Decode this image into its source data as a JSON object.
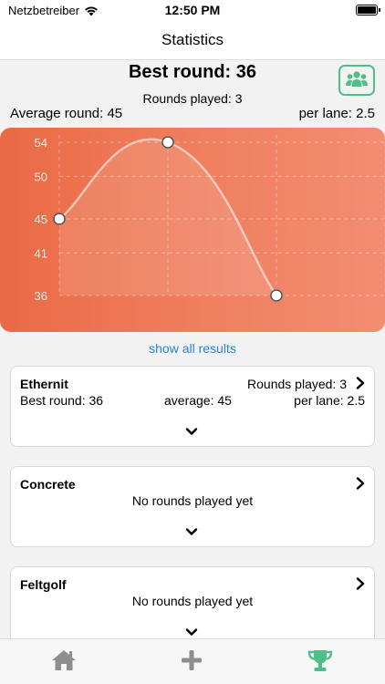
{
  "status_bar": {
    "carrier": "Netzbetreiber",
    "time": "12:50 PM"
  },
  "nav": {
    "title": "Statistics"
  },
  "summary": {
    "best_round": "Best round: 36",
    "rounds_played": "Rounds played: 3",
    "average_round": "Average round: 45",
    "per_lane": "per lane: 2.5"
  },
  "icons": {
    "group": "group-icon",
    "chevron_right": "chevron-right-icon",
    "chevron_down": "chevron-down-icon",
    "home": "home-icon",
    "plus": "plus-icon",
    "trophy": "trophy-icon"
  },
  "colors": {
    "accent_green": "#4fbf8a",
    "link_blue": "#2a86d9",
    "chart_orange": "#ef7e5e"
  },
  "chart_data": {
    "type": "line",
    "x": [
      1,
      2,
      3
    ],
    "values": [
      45,
      54,
      36
    ],
    "y_ticks": [
      "54",
      "50",
      "45",
      "41",
      "36"
    ],
    "ylim": [
      36,
      54
    ],
    "grid": true,
    "title": "",
    "xlabel": "",
    "ylabel": ""
  },
  "show_all": "show all results",
  "cards": [
    {
      "name": "Ethernit",
      "rounds_played": "Rounds played: 3",
      "best_round": "Best round: 36",
      "average": "average: 45",
      "per_lane": "per lane: 2.5"
    },
    {
      "name": "Concrete",
      "empty_text": "No rounds played yet"
    },
    {
      "name": "Feltgolf",
      "empty_text": "No rounds played yet"
    }
  ]
}
